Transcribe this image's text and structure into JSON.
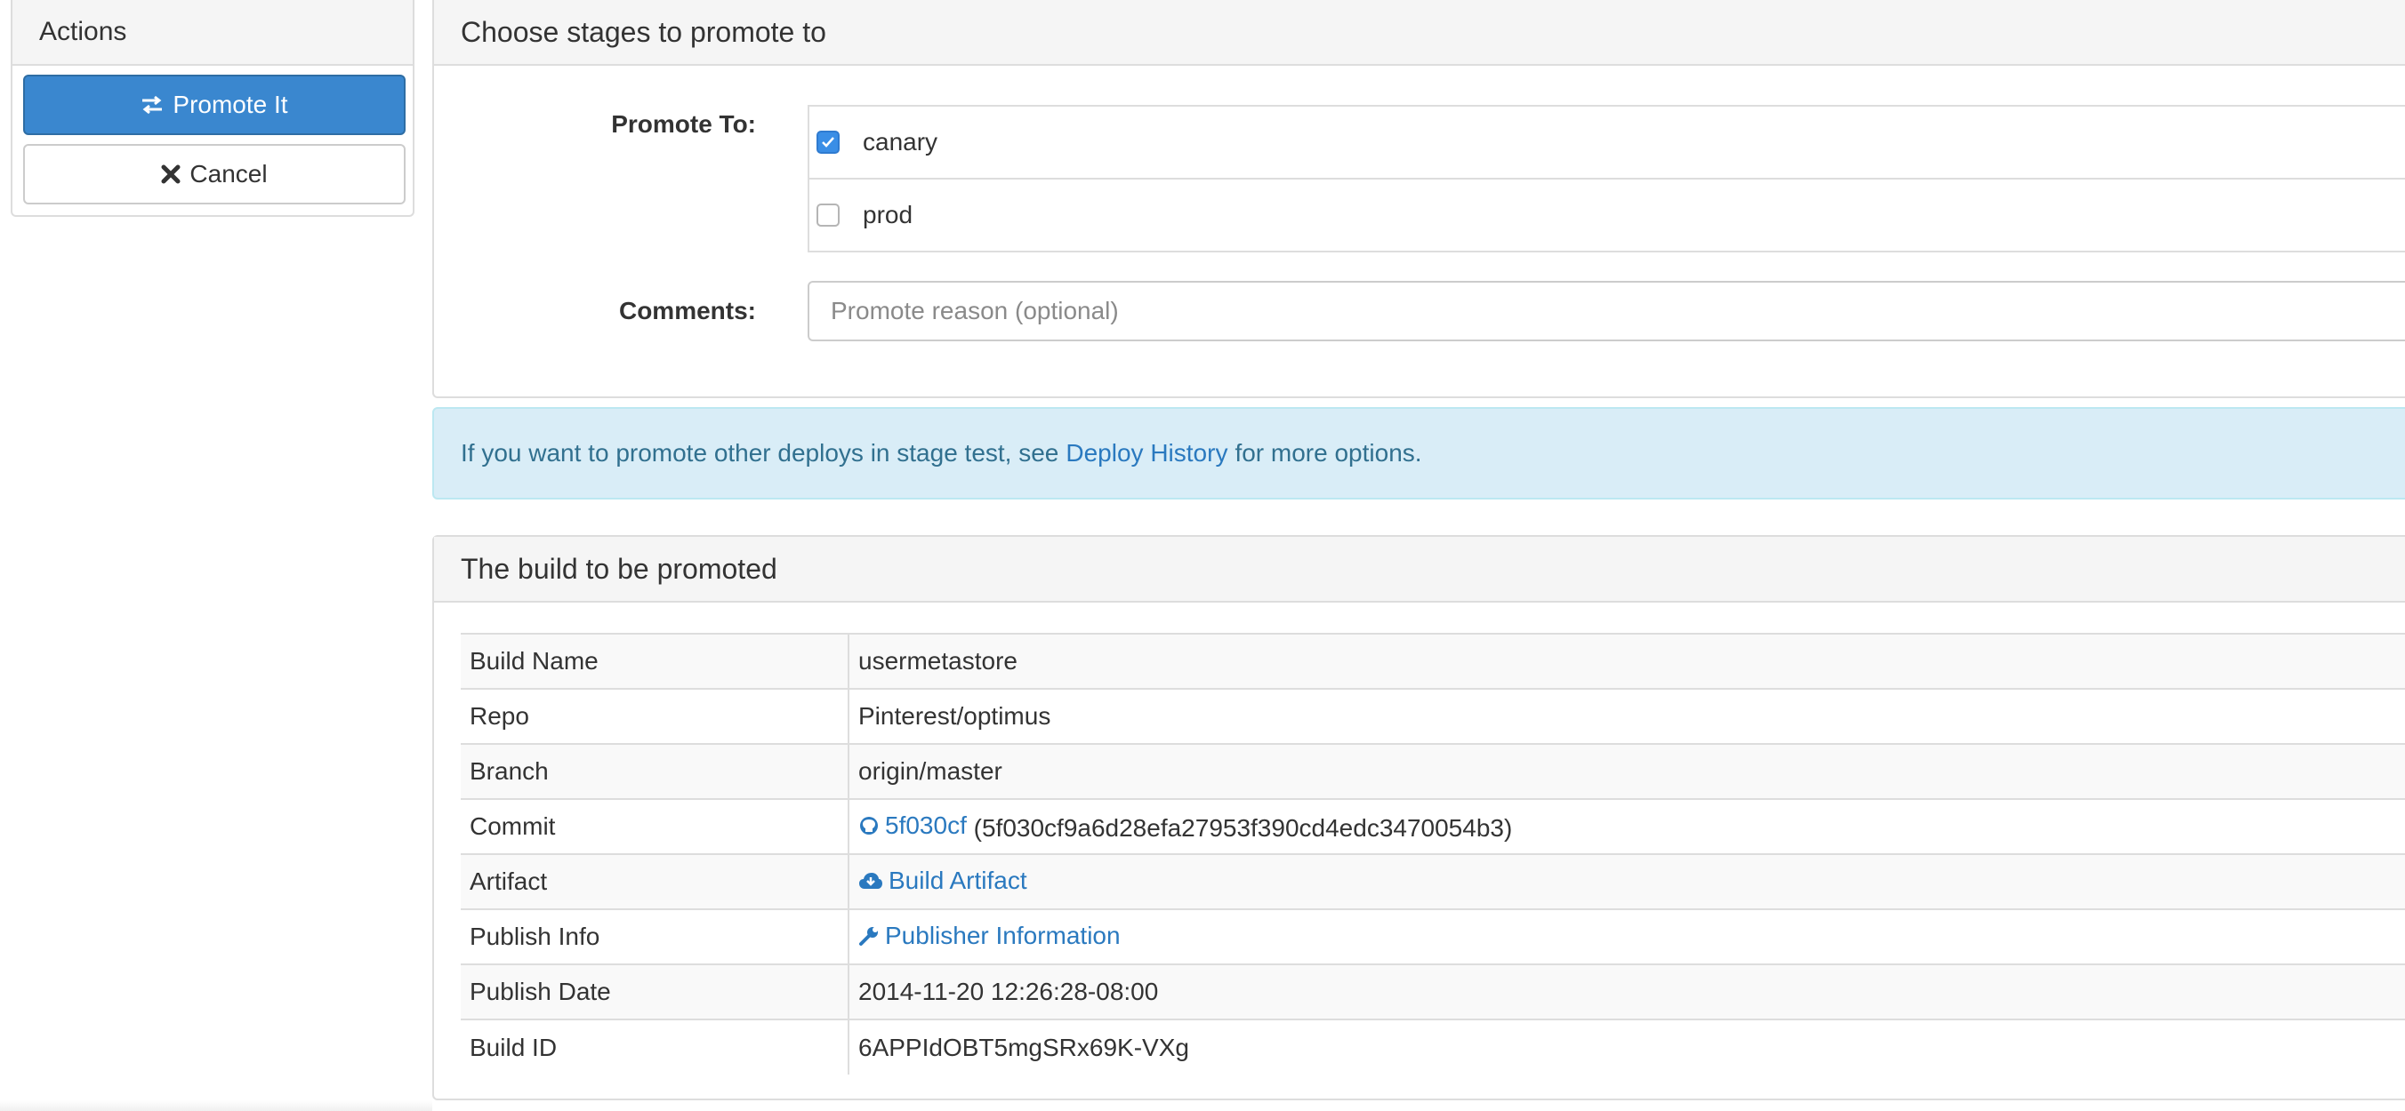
{
  "actions": {
    "heading": "Actions",
    "promote_label": "Promote It",
    "cancel_label": "Cancel"
  },
  "stages": {
    "heading": "Choose stages to promote to",
    "promote_to_label": "Promote To:",
    "options": [
      {
        "name": "canary",
        "checked": true
      },
      {
        "name": "prod",
        "checked": false
      }
    ],
    "comments_label": "Comments:",
    "comments_placeholder": "Promote reason (optional)",
    "comments_value": ""
  },
  "alert": {
    "text_before": "If you want to promote other deploys in stage test, see",
    "link_text": "Deploy History",
    "text_after": "for more options."
  },
  "build": {
    "heading": "The build to be promoted",
    "rows": {
      "build_name": {
        "key": "Build Name",
        "value": "usermetastore"
      },
      "repo": {
        "key": "Repo",
        "value": "Pinterest/optimus"
      },
      "branch": {
        "key": "Branch",
        "value": "origin/master"
      },
      "commit": {
        "key": "Commit",
        "short": "5f030cf",
        "full": "(5f030cf9a6d28efa27953f390cd4edc3470054b3)"
      },
      "artifact": {
        "key": "Artifact",
        "value": "Build Artifact"
      },
      "publish_info": {
        "key": "Publish Info",
        "value": "Publisher Information"
      },
      "publish_date": {
        "key": "Publish Date",
        "value": "2014-11-20 12:26:28-08:00"
      },
      "build_id": {
        "key": "Build ID",
        "value": "6APPIdOBT5mgSRx69K-VXg"
      }
    }
  },
  "colors": {
    "primary": "#3a87cf",
    "link": "#2a79bf",
    "alert_bg": "#d9edf7",
    "alert_text": "#31708f"
  }
}
